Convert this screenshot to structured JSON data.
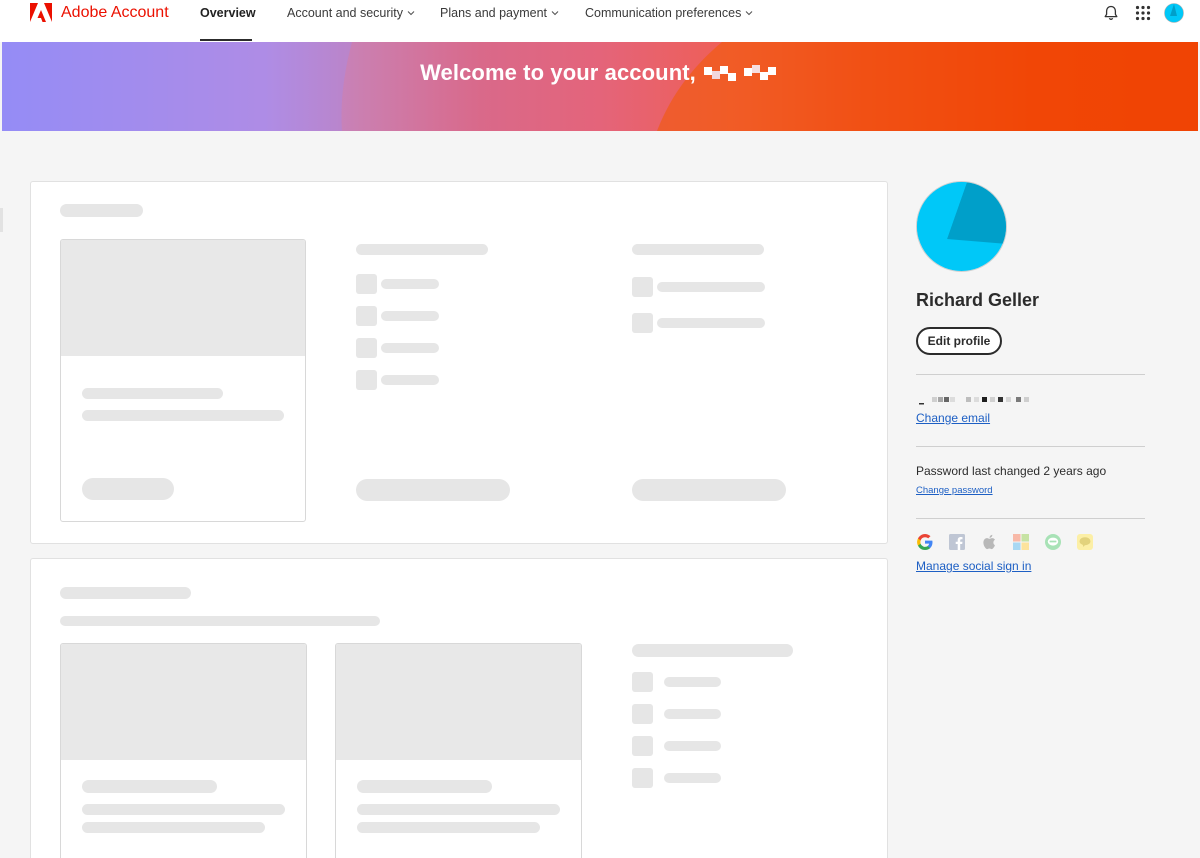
{
  "app": {
    "brand_name": "Adobe Account"
  },
  "nav": {
    "tabs": [
      {
        "label": "Overview",
        "active": true
      },
      {
        "label": "Account and security",
        "has_dropdown": true
      },
      {
        "label": "Plans and payment",
        "has_dropdown": true
      },
      {
        "label": "Communication preferences",
        "has_dropdown": true
      }
    ],
    "icons": [
      "bell-icon",
      "app-grid-icon",
      "avatar"
    ]
  },
  "hero": {
    "title": "Welcome to your account,"
  },
  "profile": {
    "name": "Richard Geller",
    "edit_label": "Edit profile",
    "change_email": "Change email",
    "password_status": "Password last changed 2 years ago",
    "change_password": "Change password",
    "social_icons": [
      "google-icon",
      "facebook-icon",
      "apple-icon",
      "microsoft-icon",
      "line-icon",
      "kakaotalk-icon"
    ],
    "manage_social": "Manage social sign in"
  },
  "colors": {
    "brand": "#eb1000",
    "link": "#1d5fc4",
    "avatar_primary": "#00c8f8",
    "avatar_secondary": "#009fc9",
    "skeleton": "#e6e6e6"
  }
}
